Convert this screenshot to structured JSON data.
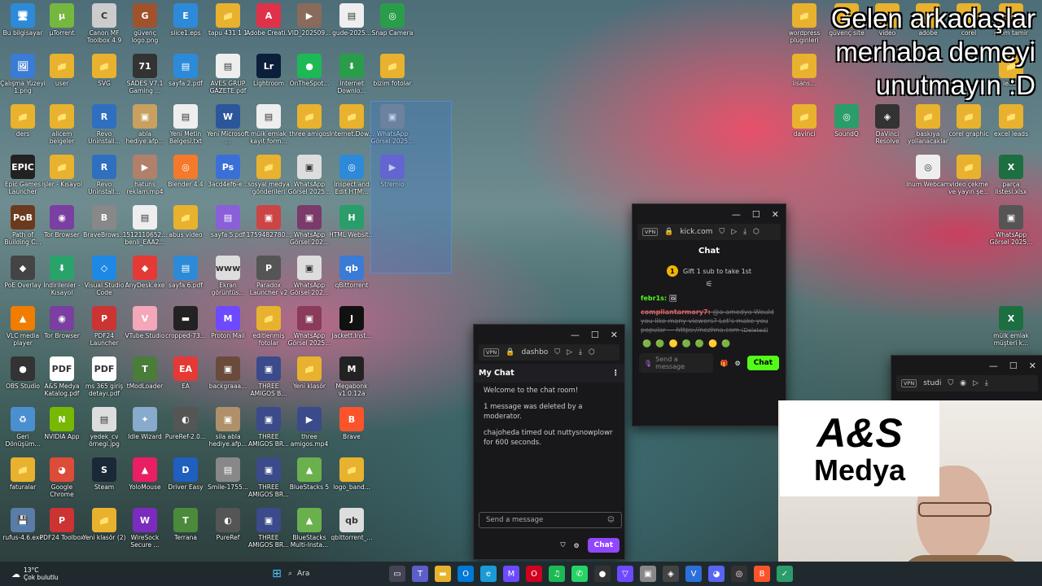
{
  "overlay_text": [
    "Gelen arkadaşlar",
    "merhaba demeyi",
    "unutmayın :D"
  ],
  "desktop_icons": [
    {
      "label": "Bu bilgisayar",
      "color": "#2d8ad8",
      "glyph": "🖥"
    },
    {
      "label": "Çalışma Yüzeyi 1.png",
      "color": "#3a7bd5",
      "glyph": "🖼"
    },
    {
      "label": "ders",
      "color": "#e8b22e",
      "glyph": "📁"
    },
    {
      "label": "Epic Games Launcher",
      "color": "#222",
      "glyph": "EPIC"
    },
    {
      "label": "Path of Building C...",
      "color": "#6b3a1e",
      "glyph": "PoB"
    },
    {
      "label": "PoE Overlay",
      "color": "#444",
      "glyph": "◆"
    },
    {
      "label": "VLC media player",
      "color": "#f07d00",
      "glyph": "▲"
    },
    {
      "label": "OBS Studio",
      "color": "#333",
      "glyph": "●"
    },
    {
      "label": "Geri Dönüşüm...",
      "color": "#4a8fd0",
      "glyph": "♻"
    },
    {
      "label": "faturalar",
      "color": "#e8b22e",
      "glyph": "📁"
    },
    {
      "label": "rufus-4.6.exe",
      "color": "#5a7ca8",
      "glyph": "💾"
    },
    {
      "label": "µTorrent",
      "color": "#76b83f",
      "glyph": "µ"
    },
    {
      "label": "user",
      "color": "#e8b22e",
      "glyph": "📁"
    },
    {
      "label": "alicem belgeler",
      "color": "#e8b22e",
      "glyph": "📁"
    },
    {
      "label": "işler - Kısayol",
      "color": "#e8b22e",
      "glyph": "📁"
    },
    {
      "label": "Tor Browser",
      "color": "#7a3fa0",
      "glyph": "◉"
    },
    {
      "label": "İndirilenler - Kısayol",
      "color": "#2aa36a",
      "glyph": "⬇"
    },
    {
      "label": "Tor Browser",
      "color": "#7a3fa0",
      "glyph": "◉"
    },
    {
      "label": "A&S Medya Katalog.pdf",
      "color": "#fff",
      "glyph": "PDF"
    },
    {
      "label": "NVIDIA App",
      "color": "#76b900",
      "glyph": "N"
    },
    {
      "label": "Google Chrome",
      "color": "#dd4b39",
      "glyph": "◕"
    },
    {
      "label": "PDF24 Toolbox",
      "color": "#c33",
      "glyph": "P"
    },
    {
      "label": "Canon MF Toolbox 4.9",
      "color": "#ccc",
      "glyph": "C"
    },
    {
      "label": "SVG",
      "color": "#e8b22e",
      "glyph": "📁"
    },
    {
      "label": "Revo Uninstall...",
      "color": "#2f6fbf",
      "glyph": "R"
    },
    {
      "label": "Revo Uninstall...",
      "color": "#2f6fbf",
      "glyph": "R"
    },
    {
      "label": "BraveBrows...",
      "color": "#888",
      "glyph": "B"
    },
    {
      "label": "Visual Studio Code",
      "color": "#1e88e5",
      "glyph": "◇"
    },
    {
      "label": "PDF24 Launcher",
      "color": "#c33",
      "glyph": "P"
    },
    {
      "label": "ms 365 giriş detayı.pdf",
      "color": "#fff",
      "glyph": "PDF"
    },
    {
      "label": "yedek_cv örnegi.jpg",
      "color": "#ddd",
      "glyph": "▤"
    },
    {
      "label": "Steam",
      "color": "#1b2838",
      "glyph": "S"
    },
    {
      "label": "Yeni klasör (2)",
      "color": "#e8b22e",
      "glyph": "📁"
    },
    {
      "label": "güvenç logo.png",
      "color": "#a0522d",
      "glyph": "G"
    },
    {
      "label": "SADES V7.1 Gaming ...",
      "color": "#333",
      "glyph": "71"
    },
    {
      "label": "abla hediye.afp...",
      "color": "#c8a060",
      "glyph": "▣"
    },
    {
      "label": "hatuns reklam.mp4",
      "color": "#b0806a",
      "glyph": "▶"
    },
    {
      "label": "1512110652... benli_EAA2...",
      "color": "#eee",
      "glyph": "▤"
    },
    {
      "label": "AnyDesk.exe",
      "color": "#e53935",
      "glyph": "◆"
    },
    {
      "label": "VTube Studio",
      "color": "#f4a7b9",
      "glyph": "V"
    },
    {
      "label": "tModLoader",
      "color": "#4a7c3a",
      "glyph": "T"
    },
    {
      "label": "Idle Wizard",
      "color": "#88aacc",
      "glyph": "✦"
    },
    {
      "label": "YoloMouse",
      "color": "#e91e63",
      "glyph": "▲"
    },
    {
      "label": "WireSock Secure ...",
      "color": "#7b2cbf",
      "glyph": "W"
    },
    {
      "label": "slice1.eps",
      "color": "#2d8ad8",
      "glyph": "E"
    },
    {
      "label": "sayfa 2.pdf",
      "color": "#2d8ad8",
      "glyph": "▤"
    },
    {
      "label": "Yeni Metin Belgesi.txt",
      "color": "#eee",
      "glyph": "▤"
    },
    {
      "label": "Blender 4.4",
      "color": "#f5792a",
      "glyph": "◎"
    },
    {
      "label": "abus video",
      "color": "#e8b22e",
      "glyph": "📁"
    },
    {
      "label": "sayfa 6.pdf",
      "color": "#2d8ad8",
      "glyph": "▤"
    },
    {
      "label": "cropped-73...",
      "color": "#222",
      "glyph": "▬"
    },
    {
      "label": "EA",
      "color": "#e53935",
      "glyph": "EA"
    },
    {
      "label": "PureRef-2.0...",
      "color": "#555",
      "glyph": "◐"
    },
    {
      "label": "Driver Easy",
      "color": "#1e5fbf",
      "glyph": "D"
    },
    {
      "label": "Terrana",
      "color": "#4a8a3a",
      "glyph": "T"
    },
    {
      "label": "tapu 431 1 1",
      "color": "#e8b22e",
      "glyph": "📁"
    },
    {
      "label": "AVES GRUP GAZETE.pdf",
      "color": "#eee",
      "glyph": "▤"
    },
    {
      "label": "Yeni Microsoft ...",
      "color": "#2b579a",
      "glyph": "W"
    },
    {
      "label": "3acd4ef6-e...",
      "color": "#3b6fd8",
      "glyph": "Ps"
    },
    {
      "label": "sayfa 5.pdf",
      "color": "#8a5fd8",
      "glyph": "▤"
    },
    {
      "label": "Ekran görüntüs...",
      "color": "#ddd",
      "glyph": "www"
    },
    {
      "label": "Proton Mail",
      "color": "#6d4aff",
      "glyph": "M"
    },
    {
      "label": "backgraaa...",
      "color": "#6a4a3a",
      "glyph": "▣"
    },
    {
      "label": "sila abla hediye.afp...",
      "color": "#b0906a",
      "glyph": "▣"
    },
    {
      "label": "Smile-1755...",
      "color": "#888",
      "glyph": "▤"
    },
    {
      "label": "PureRef",
      "color": "#555",
      "glyph": "◐"
    },
    {
      "label": "Adobe Creati...",
      "color": "#e0314b",
      "glyph": "A"
    },
    {
      "label": "Lightroom",
      "color": "#0b1e3a",
      "glyph": "Lr"
    },
    {
      "label": "mülk emlak kayıt form...",
      "color": "#eee",
      "glyph": "▤"
    },
    {
      "label": "sosyal medya gönderileri",
      "color": "#e8b22e",
      "glyph": "📁"
    },
    {
      "label": "1759482780...",
      "color": "#c44",
      "glyph": "▣"
    },
    {
      "label": "Paradox Launcher v2",
      "color": "#555",
      "glyph": "P"
    },
    {
      "label": "editlenmiş fotolar",
      "color": "#e8b22e",
      "glyph": "📁"
    },
    {
      "label": "THREE AMIGOS B...",
      "color": "#3a4a8a",
      "glyph": "▣"
    },
    {
      "label": "THREE AMIGOS BR...",
      "color": "#3a4a8a",
      "glyph": "▣"
    },
    {
      "label": "THREE AMIGOS BR...",
      "color": "#3a4a8a",
      "glyph": "▣"
    },
    {
      "label": "THREE AMIGOS BR...",
      "color": "#3a4a8a",
      "glyph": "▣"
    },
    {
      "label": "VID_202509...",
      "color": "#8a6a5a",
      "glyph": "▶"
    },
    {
      "label": "OnTheSpot...",
      "color": "#1db954",
      "glyph": "●"
    },
    {
      "label": "three amigos",
      "color": "#e8b22e",
      "glyph": "📁"
    },
    {
      "label": "WhatsApp Görsel 2025...",
      "color": "#ddd",
      "glyph": "▣"
    },
    {
      "label": "WhatsApp Görsel 202...",
      "color": "#7a3a6a",
      "glyph": "▣"
    },
    {
      "label": "WhatsApp Görsel 202...",
      "color": "#ddd",
      "glyph": "▣"
    },
    {
      "label": "WhatsApp Görsel 2025...",
      "color": "#8a3a5a",
      "glyph": "▣"
    },
    {
      "label": "Yeni klasör",
      "color": "#e8b22e",
      "glyph": "📁"
    },
    {
      "label": "three amigos.mp4",
      "color": "#3a4a8a",
      "glyph": "▶"
    },
    {
      "label": "BlueStacks 5",
      "color": "#6ab04c",
      "glyph": "▲"
    },
    {
      "label": "BlueStacks Multi-Insta...",
      "color": "#6ab04c",
      "glyph": "▲"
    },
    {
      "label": "gude-2025...",
      "color": "#eee",
      "glyph": "▤"
    },
    {
      "label": "Internet Downlo...",
      "color": "#2a9d4a",
      "glyph": "⬇"
    },
    {
      "label": "Internet.Dow...",
      "color": "#e8b22e",
      "glyph": "📁"
    },
    {
      "label": "Inspect and Edit HTM...",
      "color": "#2d8ad8",
      "glyph": "◎"
    },
    {
      "label": "HTML Websit...",
      "color": "#2a9d6a",
      "glyph": "H"
    },
    {
      "label": "qBittorrent",
      "color": "#3a7bd5",
      "glyph": "qb"
    },
    {
      "label": "Jackett.Inst...",
      "color": "#111",
      "glyph": "J"
    },
    {
      "label": "Megabonk v1.0.12a",
      "color": "#222",
      "glyph": "M"
    },
    {
      "label": "Brave",
      "color": "#fb542b",
      "glyph": "B"
    },
    {
      "label": "logo_band...",
      "color": "#e8b22e",
      "glyph": "📁"
    },
    {
      "label": "qbittorrent_...",
      "color": "#ddd",
      "glyph": "qb"
    },
    {
      "label": "Snap Camera",
      "color": "#2a9d4a",
      "glyph": "◎"
    },
    {
      "label": "bizim fotolar",
      "color": "#e8b22e",
      "glyph": "📁"
    },
    {
      "label": "WhatsApp Görsel 2025...",
      "color": "#888",
      "glyph": "▣"
    },
    {
      "label": "Stremio",
      "color": "#7b5bd6",
      "glyph": "▶"
    }
  ],
  "right_icons": [
    {
      "label": "wordpress pluginleri",
      "color": "#e8b22e",
      "glyph": "📁"
    },
    {
      "label": "güvenç site",
      "color": "#e8b22e",
      "glyph": "📁"
    },
    {
      "label": "video",
      "color": "#e8b22e",
      "glyph": "📁"
    },
    {
      "label": "adobe",
      "color": "#e8b22e",
      "glyph": "📁"
    },
    {
      "label": "corel",
      "color": "#e8b22e",
      "glyph": "📁"
    },
    {
      "label": "prom tamir",
      "color": "#e8b22e",
      "glyph": "📁"
    },
    {
      "label": "lisans...",
      "color": "#e8b22e",
      "glyph": "📁"
    },
    {
      "label": "leads",
      "color": "#e8b22e",
      "glyph": "📁"
    },
    {
      "label": "davinci",
      "color": "#e8b22e",
      "glyph": "📁"
    },
    {
      "label": "SoundQ",
      "color": "#2a9d6a",
      "glyph": "◎"
    },
    {
      "label": "DaVinci Resolve",
      "color": "#333",
      "glyph": "◈"
    },
    {
      "label": "baskıya yollanacaklar",
      "color": "#e8b22e",
      "glyph": "📁"
    },
    {
      "label": "corel graphic",
      "color": "#e8b22e",
      "glyph": "📁"
    },
    {
      "label": "excel leads",
      "color": "#e8b22e",
      "glyph": "📁"
    },
    {
      "label": "Inum Webcam",
      "color": "#eee",
      "glyph": "◎"
    },
    {
      "label": "video çekme ve yayın şe...",
      "color": "#e8b22e",
      "glyph": "📁"
    },
    {
      "label": "parça listesi.xlsx",
      "color": "#1d6f42",
      "glyph": "X"
    },
    {
      "label": "WhatsApp Görsel 2025...",
      "color": "#555",
      "glyph": "▣"
    },
    {
      "label": "mülk emlak müşteri k...",
      "color": "#1d6f42",
      "glyph": "X"
    }
  ],
  "kick_window": {
    "url": "kick.com",
    "vpn": "VPN",
    "title": "Chat",
    "gift_text": "Gift 1 sub to take 1st",
    "gift_count": "1",
    "user1": "febr1s:",
    "user2": "compliantarmory7:",
    "msg2": "@a-amedya Would you like many viewers? Let's make you popular — https://nezhna.com",
    "deleted": "(Deleted)",
    "send_placeholder": "Send a message",
    "chat_btn": "Chat"
  },
  "dash_window": {
    "url": "dashbo",
    "vpn": "VPN",
    "title": "My Chat",
    "messages": [
      "Welcome to the chat room!",
      "1 message was deleted by a moderator.",
      "chajoheda timed out nuttysnowplowr for 600 seconds."
    ],
    "send_placeholder": "Send a message",
    "chat_btn": "Chat"
  },
  "studio_window": {
    "url": "studi",
    "vpn": "VPN"
  },
  "logo": {
    "line1": "A&S",
    "line2": "Medya"
  },
  "taskbar": {
    "weather_temp": "13°C",
    "weather_desc": "Çok bulutlu",
    "search": "Ara"
  }
}
